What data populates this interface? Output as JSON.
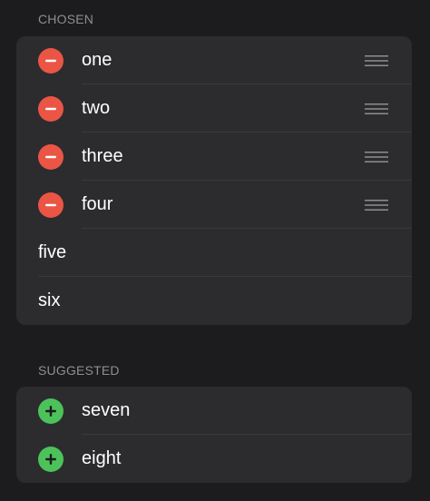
{
  "chosen": {
    "header": "CHOSEN",
    "removable_items": [
      {
        "label": "one",
        "action_icon": "minus-circle-icon",
        "handle_icon": "drag-handle-icon"
      },
      {
        "label": "two",
        "action_icon": "minus-circle-icon",
        "handle_icon": "drag-handle-icon"
      },
      {
        "label": "three",
        "action_icon": "minus-circle-icon",
        "handle_icon": "drag-handle-icon"
      },
      {
        "label": "four",
        "action_icon": "minus-circle-icon",
        "handle_icon": "drag-handle-icon"
      }
    ],
    "fixed_items": [
      {
        "label": "five"
      },
      {
        "label": "six"
      }
    ]
  },
  "suggested": {
    "header": "SUGGESTED",
    "items": [
      {
        "label": "seven",
        "action_icon": "plus-circle-icon"
      },
      {
        "label": "eight",
        "action_icon": "plus-circle-icon"
      }
    ]
  },
  "colors": {
    "background": "#1c1c1e",
    "group_background": "#2c2c2e",
    "separator": "#3a3a3c",
    "header_text": "#8e8e93",
    "remove": "#eb5545",
    "add": "#4cc25b",
    "handle": "#8e8e93"
  }
}
